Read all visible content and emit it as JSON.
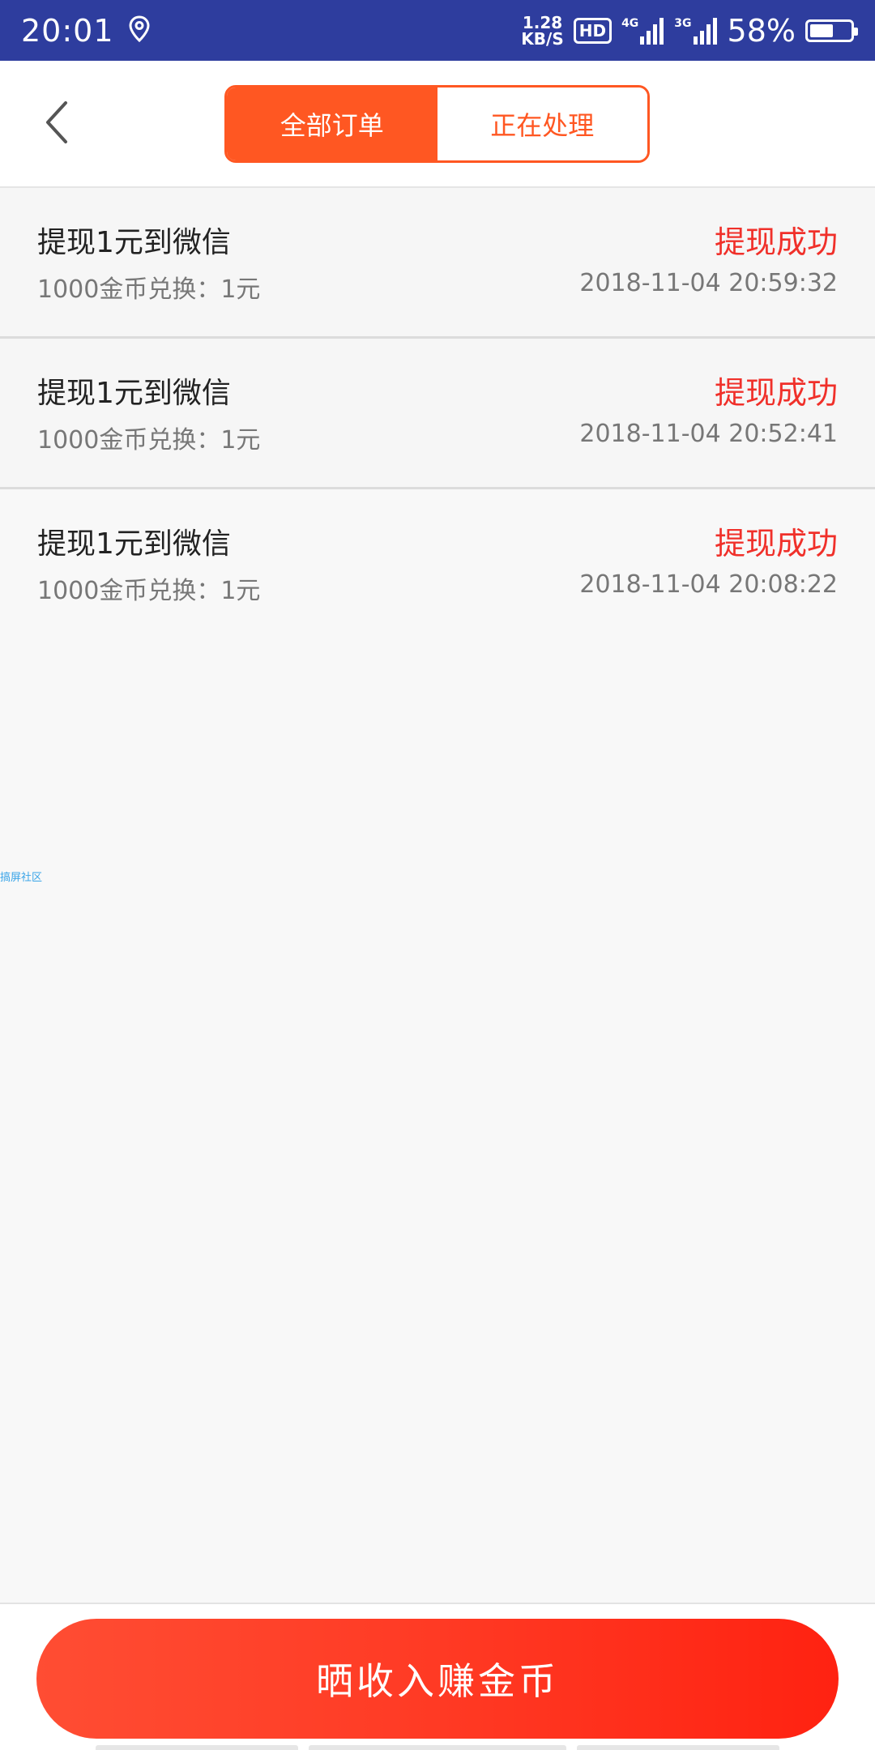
{
  "status_bar": {
    "time": "20:01",
    "speed_value": "1.28",
    "speed_unit": "KB/S",
    "hd": "HD",
    "net1": "4G",
    "net2": "3G",
    "battery": "58%",
    "battery_level": 0.58
  },
  "header": {
    "tabs": [
      {
        "label": "全部订单",
        "active": true
      },
      {
        "label": "正在处理",
        "active": false
      }
    ]
  },
  "orders": [
    {
      "title": "提现1元到微信",
      "subtitle": "1000金币兑换：1元",
      "status": "提现成功",
      "time": "2018-11-04 20:59:32"
    },
    {
      "title": "提现1元到微信",
      "subtitle": "1000金币兑换：1元",
      "status": "提现成功",
      "time": "2018-11-04 20:52:41"
    },
    {
      "title": "提现1元到微信",
      "subtitle": "1000金币兑换：1元",
      "status": "提现成功",
      "time": "2018-11-04 20:08:22"
    }
  ],
  "watermark": "搞屏社区",
  "cta_label": "晒收入赚金币",
  "colors": {
    "status_bar": "#2e3d9e",
    "accent": "#ff5722",
    "status_success": "#f0302a",
    "cta_start": "#ff4d33",
    "cta_end": "#ff2211"
  }
}
